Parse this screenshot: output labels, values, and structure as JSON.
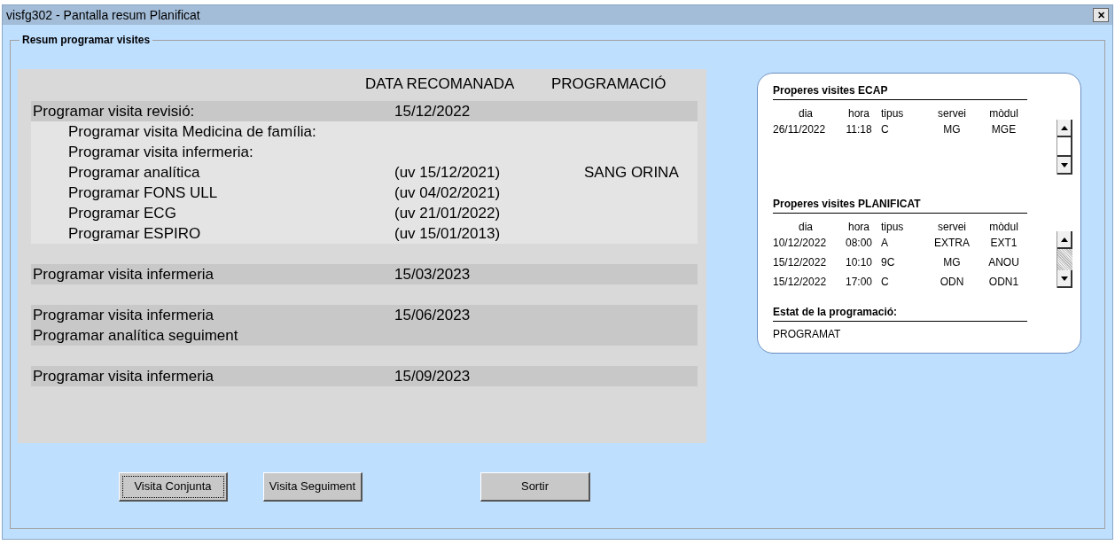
{
  "window": {
    "title": "visfg302 - Pantalla resum Planificat",
    "close": "✕"
  },
  "group_title": "Resum programar visites",
  "summary": {
    "columns": [
      "DATA RECOMANADA",
      "PROGRAMACIÓ"
    ],
    "groups": [
      {
        "lines": [
          {
            "kind": "header",
            "label": "Programar visita revisió:",
            "date": "15/12/2022"
          },
          {
            "kind": "sub",
            "label": "Programar visita Medicina de família:"
          },
          {
            "kind": "sub",
            "label": "Programar visita infermeria:"
          },
          {
            "kind": "sub",
            "label": "Programar analítica",
            "date": "(uv 15/12/2021)",
            "programming": "SANG ORINA"
          },
          {
            "kind": "sub",
            "label": "Programar FONS ULL",
            "date": "(uv 04/02/2021)"
          },
          {
            "kind": "sub",
            "label": "Programar ECG",
            "date": "(uv 21/01/2022)"
          },
          {
            "kind": "sub",
            "label": "Programar ESPIRO",
            "date": "(uv 15/01/2013)"
          }
        ]
      },
      {
        "lines": [
          {
            "kind": "header",
            "label": "Programar visita infermeria",
            "date": "15/03/2023"
          }
        ]
      },
      {
        "lines": [
          {
            "kind": "header",
            "label": "Programar visita infermeria",
            "date": "15/06/2023"
          },
          {
            "kind": "header",
            "label": "Programar analítica seguiment"
          }
        ]
      },
      {
        "lines": [
          {
            "kind": "header",
            "label": "Programar visita infermeria",
            "date": "15/09/2023"
          }
        ]
      }
    ]
  },
  "ecap": {
    "title": "Properes visites ECAP",
    "columns": [
      "dia",
      "hora",
      "tipus",
      "servei",
      "mòdul"
    ],
    "rows": [
      [
        "26/11/2022",
        "11:18",
        "C",
        "MG",
        "MGE"
      ]
    ]
  },
  "planificat": {
    "title": "Properes visites PLANIFICAT",
    "columns": [
      "dia",
      "hora",
      "tipus",
      "servei",
      "mòdul"
    ],
    "rows": [
      [
        "10/12/2022",
        "08:00",
        "A",
        "EXTRA",
        "EXT1"
      ],
      [
        "15/12/2022",
        "10:10",
        "9C",
        "MG",
        "ANOU"
      ],
      [
        "15/12/2022",
        "17:00",
        "C",
        "ODN",
        "ODN1"
      ]
    ]
  },
  "status": {
    "label": "Estat de la programació:",
    "value": "PROGRAMAT"
  },
  "buttons": [
    {
      "label": "Visita Conjunta",
      "focused": true
    },
    {
      "label": "Visita Seguiment",
      "focused": false
    },
    {
      "label": "Sortir",
      "focused": false
    }
  ]
}
